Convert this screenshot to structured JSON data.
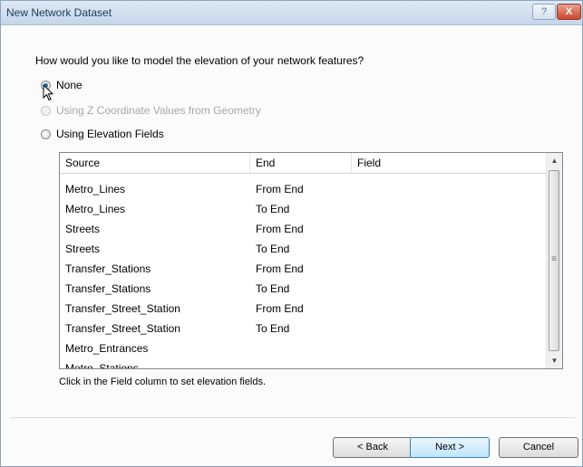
{
  "window": {
    "title": "New Network Dataset",
    "help_glyph": "?",
    "close_glyph": "X"
  },
  "question": "How would you like to model the elevation of your network features?",
  "options": [
    {
      "label": "None",
      "checked": true,
      "disabled": false
    },
    {
      "label": "Using Z Coordinate Values from Geometry",
      "checked": false,
      "disabled": true
    },
    {
      "label": "Using Elevation Fields",
      "checked": false,
      "disabled": false
    }
  ],
  "table": {
    "columns": [
      "Source",
      "End",
      "Field"
    ],
    "rows": [
      {
        "source": "Metro_Lines",
        "end": "From End",
        "field": ""
      },
      {
        "source": "Metro_Lines",
        "end": "To End",
        "field": ""
      },
      {
        "source": "Streets",
        "end": "From End",
        "field": ""
      },
      {
        "source": "Streets",
        "end": "To End",
        "field": ""
      },
      {
        "source": "Transfer_Stations",
        "end": "From End",
        "field": ""
      },
      {
        "source": "Transfer_Stations",
        "end": "To End",
        "field": ""
      },
      {
        "source": "Transfer_Street_Station",
        "end": "From End",
        "field": ""
      },
      {
        "source": "Transfer_Street_Station",
        "end": "To End",
        "field": ""
      },
      {
        "source": "Metro_Entrances",
        "end": "",
        "field": ""
      },
      {
        "source": "Metro_Stations",
        "end": "",
        "field": ""
      }
    ]
  },
  "scrollbar": {
    "up_glyph": "▲",
    "down_glyph": "▼",
    "grip_glyph": "≡"
  },
  "hint": "Click in the Field column to set elevation fields.",
  "buttons": {
    "back": "< Back",
    "next": "Next >",
    "cancel": "Cancel"
  },
  "icons": {
    "cursor": "arrow-pointer-icon"
  }
}
